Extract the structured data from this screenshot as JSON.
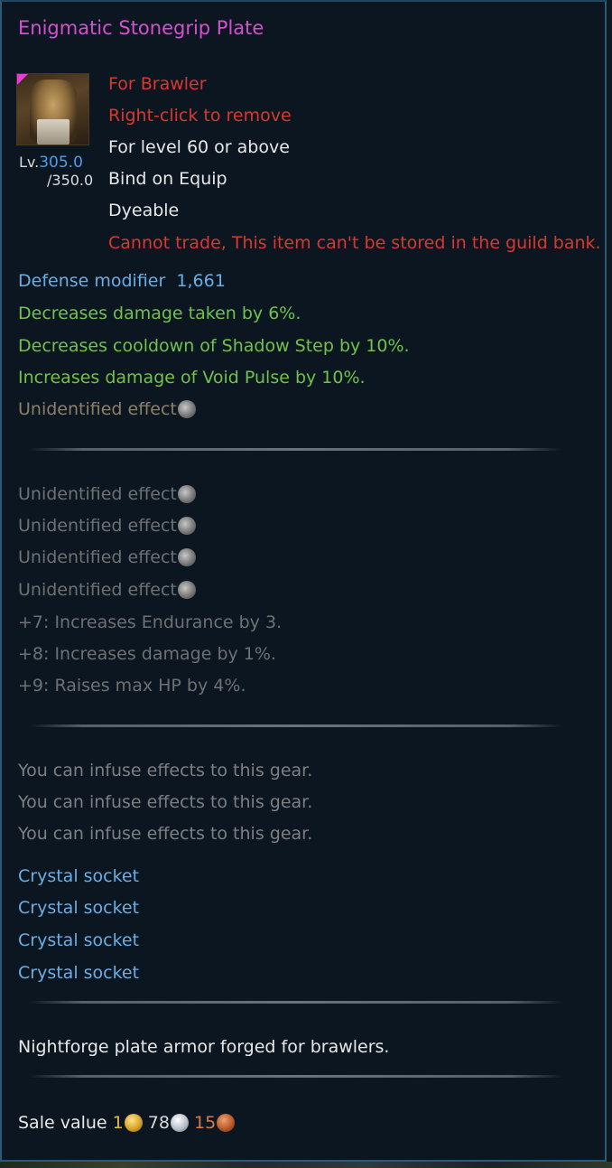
{
  "item": {
    "name": "Enigmatic Stonegrip Plate",
    "icon": "armor-chestplate-icon",
    "level_prefix": "Lv.",
    "level_current": "305.0",
    "level_max": "/350.0"
  },
  "requirements": [
    "For Brawler",
    "Right-click to remove",
    "For level 60 or above",
    "Bind on Equip",
    "Dyeable",
    "Cannot trade, This item can't be stored in the guild bank."
  ],
  "stats": {
    "defense_label": "Defense modifier",
    "defense_value": "1,661",
    "bonuses": [
      "Decreases damage taken by 6%.",
      "Decreases cooldown of Shadow Step by 10%.",
      "Increases damage of Void Pulse by 10%."
    ],
    "unidentified_primary": "Unidentified effect"
  },
  "secondary_effects": {
    "unidentified": [
      "Unidentified effect",
      "Unidentified effect",
      "Unidentified effect",
      "Unidentified effect"
    ],
    "enchant_bonuses": [
      "+7: Increases Endurance by 3.",
      "+8: Increases damage by 1%.",
      "+9: Raises max HP by 4%."
    ]
  },
  "infusion": [
    "You can infuse effects to this gear.",
    "You can infuse effects to this gear.",
    "You can infuse effects to this gear."
  ],
  "sockets": [
    "Crystal socket",
    "Crystal socket",
    "Crystal socket",
    "Crystal socket"
  ],
  "description": "Nightforge plate armor forged for brawlers.",
  "sale": {
    "label": "Sale value",
    "gold": "1",
    "silver": "78",
    "copper": "15"
  },
  "colors": {
    "title": "#d64fd0",
    "restriction": "#d8392f",
    "stat_blue": "#6aaee6",
    "bonus_green": "#6fc24d"
  }
}
